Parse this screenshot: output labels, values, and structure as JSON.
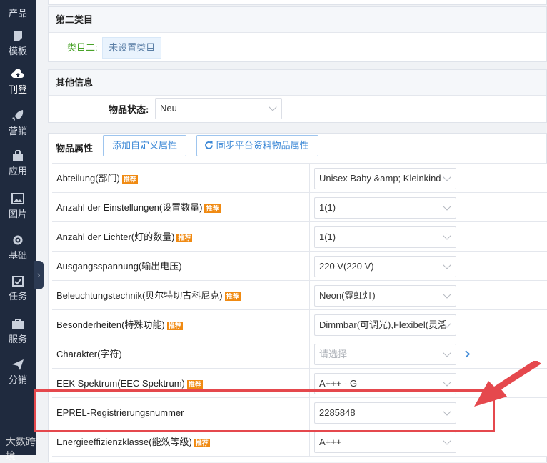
{
  "sidebar": {
    "items": [
      {
        "label": "产品",
        "icon": "product-icon"
      },
      {
        "label": "模板",
        "icon": "template-icon"
      },
      {
        "label": "刊登",
        "icon": "upload-cloud-icon",
        "active": true
      },
      {
        "label": "营销",
        "icon": "rocket-icon"
      },
      {
        "label": "应用",
        "icon": "bag-icon"
      },
      {
        "label": "图片",
        "icon": "image-icon"
      },
      {
        "label": "基础",
        "icon": "gear-icon"
      },
      {
        "label": "任务",
        "icon": "calendar-check-icon"
      },
      {
        "label": "服务",
        "icon": "briefcase-icon"
      },
      {
        "label": "分销",
        "icon": "send-icon"
      }
    ],
    "collapse_glyph": "›"
  },
  "category2": {
    "title": "第二类目",
    "label": "类目二:",
    "value": "未设置类目"
  },
  "other_info": {
    "title": "其他信息",
    "status_label": "物品状态:",
    "status_value": "Neu"
  },
  "attributes": {
    "title": "物品属性",
    "add_custom_button": "添加自定义属性",
    "sync_button": "同步平台资料物品属性",
    "badge": "推荐",
    "rows": [
      {
        "name": "Abteilung(部门)",
        "recommended": true,
        "value": "Unisex Baby &amp; Kleinkind"
      },
      {
        "name": "Anzahl der Einstellungen(设置数量)",
        "recommended": true,
        "value": "1(1)"
      },
      {
        "name": "Anzahl der Lichter(灯的数量)",
        "recommended": true,
        "value": "1(1)"
      },
      {
        "name": "Ausgangsspannung(输出电压)",
        "recommended": false,
        "value": "220 V(220 V)"
      },
      {
        "name": "Beleuchtungstechnik(贝尔特切古科尼克)",
        "recommended": true,
        "value": "Neon(霓虹灯)"
      },
      {
        "name": "Besonderheiten(特殊功能)",
        "recommended": true,
        "value": "Dimmbar(可调光),Flexibel(灵活"
      },
      {
        "name": "Charakter(字符)",
        "recommended": false,
        "value": "请选择",
        "placeholder": true,
        "has_expand": true
      },
      {
        "name": "EEK Spektrum(EEC Spektrum)",
        "recommended": true,
        "value": "A+++ - G"
      },
      {
        "name": "EPREL-Registrierungsnummer",
        "recommended": false,
        "value": "2285848"
      },
      {
        "name": "Energieeffizienzklasse(能效等级)",
        "recommended": true,
        "value": "A+++"
      }
    ]
  },
  "watermark": "大数跨境",
  "colors": {
    "sidebar_bg": "#1f2a3e",
    "highlight": "#e5484d",
    "badge": "#f08a12",
    "link_blue": "#3a87d6",
    "green_label": "#49a329"
  }
}
